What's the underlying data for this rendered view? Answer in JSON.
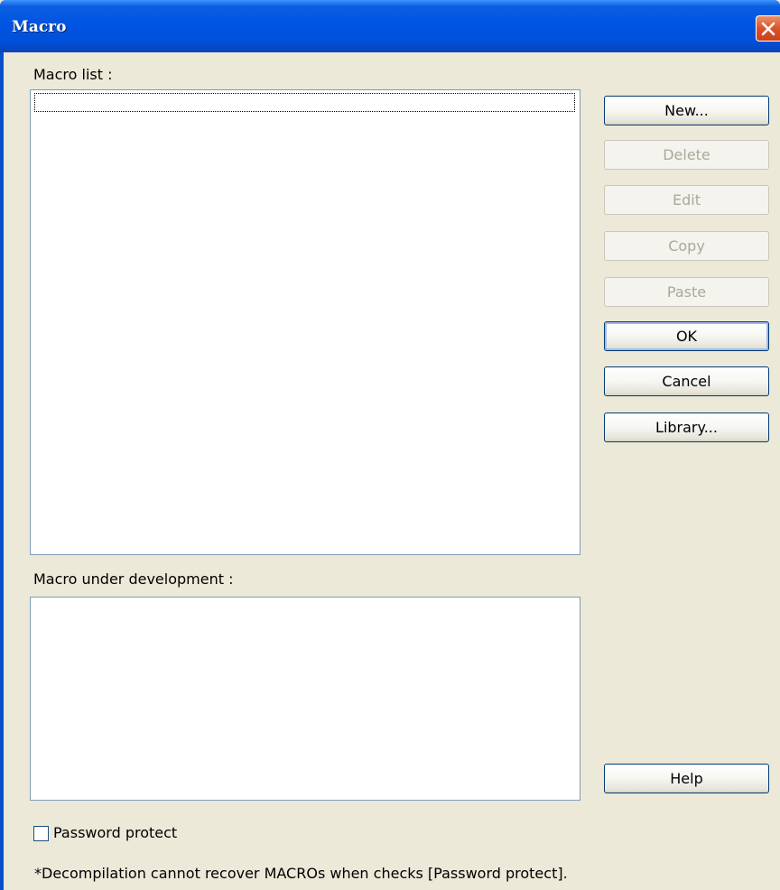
{
  "window": {
    "title": "Macro",
    "close_icon": "close-icon"
  },
  "macro_list": {
    "label": "Macro list :",
    "items": []
  },
  "macro_under_development": {
    "label": "Macro under development :"
  },
  "buttons": {
    "new": {
      "label": "New...",
      "enabled": true
    },
    "delete": {
      "label": "Delete",
      "enabled": false
    },
    "edit": {
      "label": "Edit",
      "enabled": false
    },
    "copy": {
      "label": "Copy",
      "enabled": false
    },
    "paste": {
      "label": "Paste",
      "enabled": false
    },
    "ok": {
      "label": "OK",
      "enabled": true,
      "default": true
    },
    "cancel": {
      "label": "Cancel",
      "enabled": true
    },
    "library": {
      "label": "Library...",
      "enabled": true
    },
    "help": {
      "label": "Help",
      "enabled": true
    }
  },
  "password_protect": {
    "label": "Password protect",
    "checked": false
  },
  "note": "*Decompilation cannot recover MACROs when checks [Password protect].",
  "colors": {
    "titlebar": "#0054e3",
    "dialog_bg": "#ece9d8",
    "close_button": "#d9542a",
    "disabled_text": "#aca899"
  }
}
